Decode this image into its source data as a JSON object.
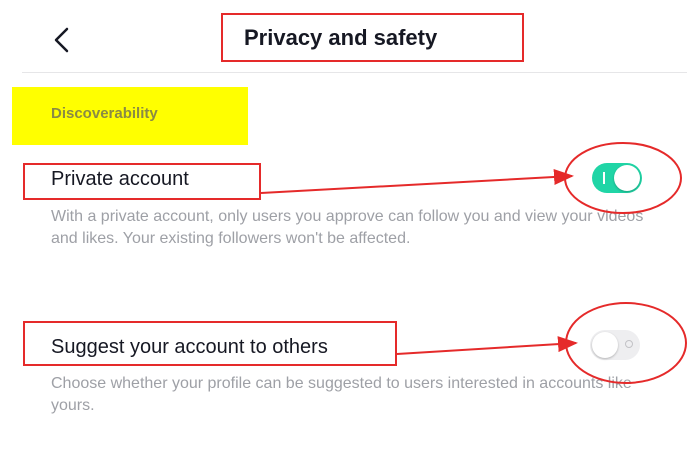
{
  "header": {
    "title": "Privacy and safety",
    "back_icon": "chevron-left-icon"
  },
  "section": {
    "label": "Discoverability"
  },
  "settings": [
    {
      "title": "Private account",
      "description": "With a private account, only users you approve can follow you and view your videos and likes. Your existing followers won't be affected.",
      "enabled": true
    },
    {
      "title": "Suggest your account to others",
      "description": "Choose whether your profile can be suggested to users interested in accounts like yours.",
      "enabled": false
    }
  ],
  "colors": {
    "toggle_on": "#20d5a6",
    "toggle_off": "#eeeef0",
    "annotation_red": "#e52a2a",
    "highlight_yellow": "#ffff00"
  }
}
